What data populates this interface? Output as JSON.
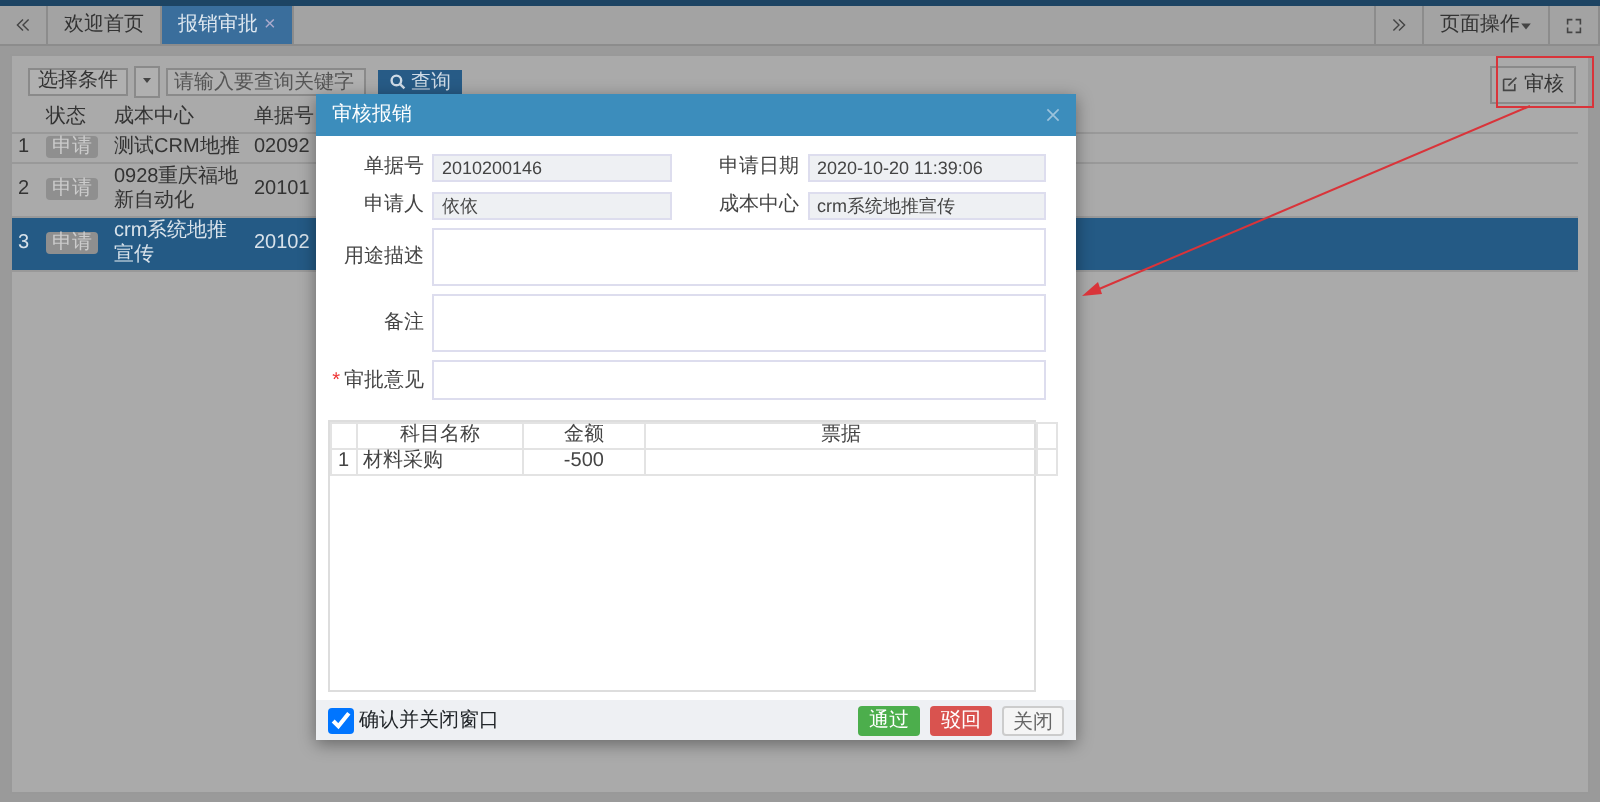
{
  "tabs": [
    {
      "label": "欢迎首页",
      "selected": false,
      "closable": false
    },
    {
      "label": "报销审批",
      "selected": true,
      "closable": true
    }
  ],
  "tab_close": "×",
  "page_menu": {
    "label": "页面操作"
  },
  "toolbar": {
    "condition": "选择条件",
    "placeholder": "请输入要查询关键字",
    "search_button": "查询",
    "audit_button": "审核"
  },
  "table": {
    "columns": [
      "状态",
      "成本中心",
      "单据号"
    ],
    "rows": [
      {
        "index": "1",
        "status": "申请",
        "center": "测试CRM地推",
        "number": "02092",
        "selected": false
      },
      {
        "index": "2",
        "status": "申请",
        "center": "0928重庆福地新自动化",
        "number": "20101",
        "selected": false
      },
      {
        "index": "3",
        "status": "申请",
        "center": "crm系统地推宣传",
        "number": "20102",
        "selected": true
      }
    ]
  },
  "dialog": {
    "title": "审核报销",
    "fields": [
      {
        "label": "单据号",
        "value": "2010200146",
        "kind": "short",
        "required": false
      },
      {
        "label": "申请日期",
        "value": "2020-10-20 11:39:06",
        "kind": "short",
        "required": false
      },
      {
        "label": "申请人",
        "value": "依依",
        "kind": "short",
        "required": false
      },
      {
        "label": "成本中心",
        "value": "crm系统地推宣传",
        "kind": "short",
        "required": false
      },
      {
        "label": "用途描述",
        "kind": "area",
        "required": false
      },
      {
        "label": "备注",
        "kind": "area",
        "required": false
      },
      {
        "label": "审批意见",
        "kind": "line",
        "required": true
      }
    ],
    "required_mark": "*",
    "detail": {
      "columns": [
        "科目名称",
        "金额",
        "票据"
      ],
      "rows": [
        {
          "index": "1",
          "cells": [
            "材料采购",
            "-500",
            ""
          ]
        }
      ]
    },
    "confirm": {
      "label": "确认并关闭窗口",
      "checked": true
    },
    "buttons": [
      {
        "label": "通过",
        "kind": "success"
      },
      {
        "label": "驳回",
        "kind": "danger"
      },
      {
        "label": "关闭",
        "kind": "plain"
      }
    ]
  }
}
